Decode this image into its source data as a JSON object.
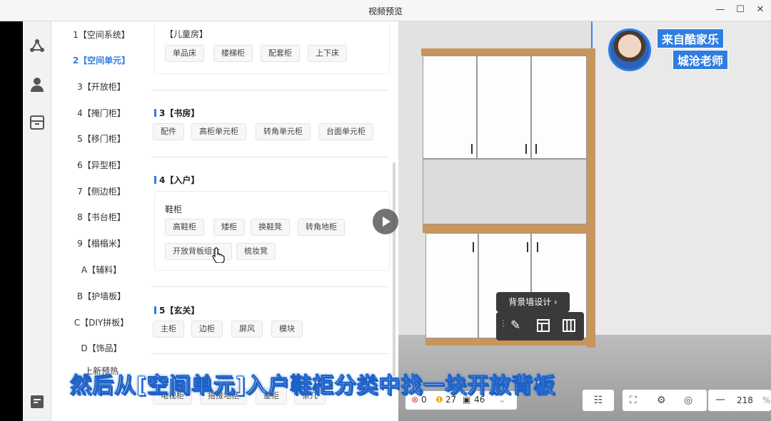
{
  "window": {
    "title": "视频预览",
    "minimize": "—",
    "maximize": "☐",
    "close": "✕"
  },
  "categories": [
    {
      "label": "1【空间系统】",
      "active": false
    },
    {
      "label": "2【空间单元】",
      "active": true
    },
    {
      "label": "3【开放柜】",
      "active": false
    },
    {
      "label": "4【掩门柜】",
      "active": false
    },
    {
      "label": "5【移门柜】",
      "active": false
    },
    {
      "label": "6【异型柜】",
      "active": false
    },
    {
      "label": "7【侧边柜】",
      "active": false
    },
    {
      "label": "8【书台柜】",
      "active": false
    },
    {
      "label": "9【榻榻米】",
      "active": false
    },
    {
      "label": "A【辅料】",
      "active": false
    },
    {
      "label": "B【护墙板】",
      "active": false
    },
    {
      "label": "C【DIY拼板】",
      "active": false
    },
    {
      "label": "D【饰品】",
      "active": false
    },
    {
      "label": "上新预热",
      "active": false
    }
  ],
  "panel": {
    "kids_room": {
      "title": "【儿童房】",
      "items": [
        "单品床",
        "楼梯柜",
        "配套柜",
        "上下床"
      ]
    },
    "study": {
      "title": "3【书房】",
      "items": [
        "配件",
        "高柜单元柜",
        "转角单元柜",
        "台面单元柜"
      ]
    },
    "entrance": {
      "title": "4【入户】",
      "group": "鞋柜",
      "items": [
        "高鞋柜",
        "矮柜",
        "换鞋凳",
        "转角地柜",
        "开放背板组合",
        "梳妆凳"
      ]
    },
    "foyer": {
      "title": "5【玄关】",
      "items": [
        "主柜",
        "边柜",
        "屏风",
        "模块"
      ]
    },
    "living": {
      "items": [
        "电视柜",
        "搭接地柜",
        "墨柜",
        "茶几"
      ]
    }
  },
  "scene": {
    "background_wall_button": "背景墙设计 ›",
    "tool_icons": [
      "drag-handle-icon",
      "pencil-icon",
      "layout-icon",
      "columns-icon"
    ]
  },
  "badge": {
    "line1": "来自酷家乐",
    "line2": "城沧老师"
  },
  "subtitle": "然后从[空间单元]入户鞋柜分类中找一块开放背板",
  "status": {
    "errors": "0",
    "warnings": "27",
    "info": "46"
  },
  "zoom": {
    "value": "218",
    "unit": "%"
  },
  "colors": {
    "accent": "#2f7de1",
    "wood": "#c8955a",
    "error": "#e53935",
    "warning": "#f5a623"
  }
}
